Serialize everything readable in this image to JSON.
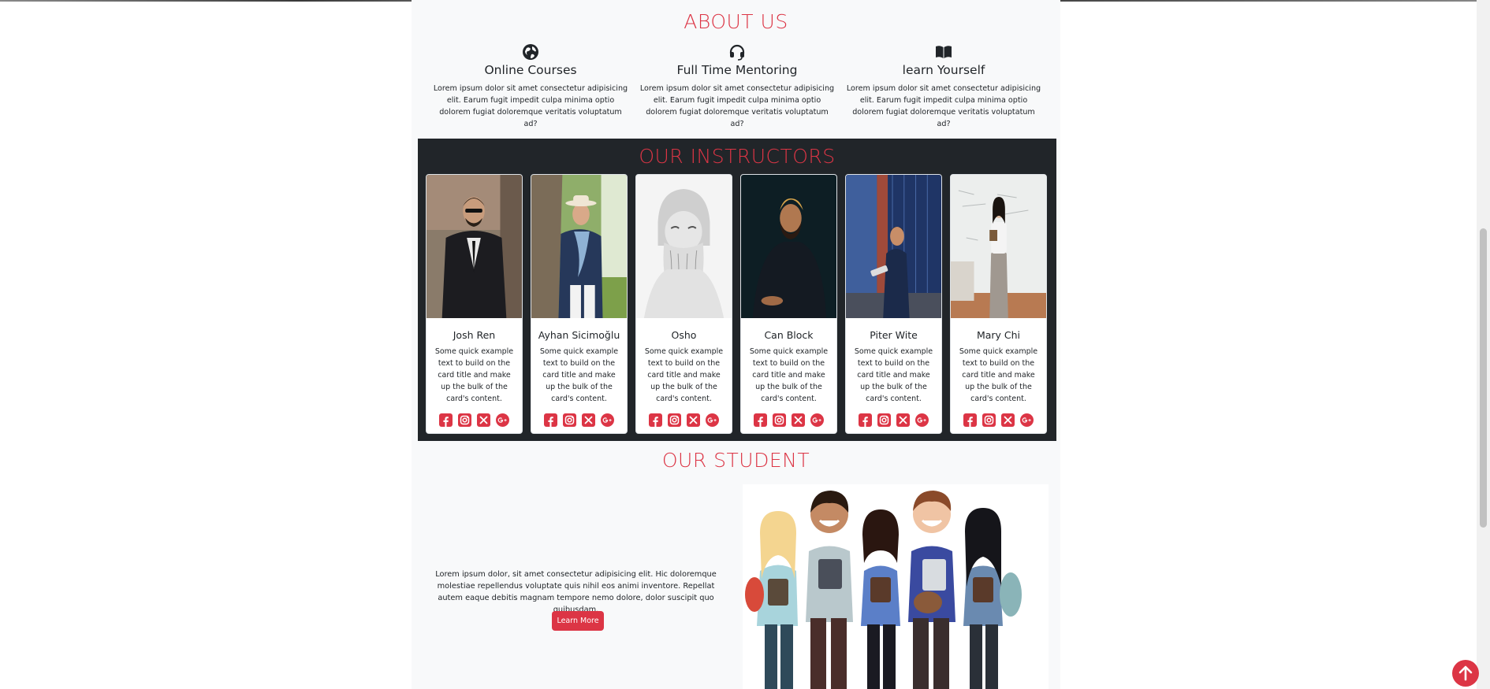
{
  "about": {
    "title": "ABOUT US",
    "features": [
      {
        "icon": "globe-icon",
        "title": "Online Courses",
        "text": "Lorem ipsum dolor sit amet consectetur adipisicing elit. Earum fugit impedit culpa minima optio dolorem fugiat doloremque veritatis voluptatum ad?"
      },
      {
        "icon": "headset-icon",
        "title": "Full Time Mentoring",
        "text": "Lorem ipsum dolor sit amet consectetur adipisicing elit. Earum fugit impedit culpa minima optio dolorem fugiat doloremque veritatis voluptatum ad?"
      },
      {
        "icon": "book-icon",
        "title": "learn Yourself",
        "text": "Lorem ipsum dolor sit amet consectetur adipisicing elit. Earum fugit impedit culpa minima optio dolorem fugiat doloremque veritatis voluptatum ad?"
      }
    ]
  },
  "instructors": {
    "title": "OUR INSTRUCTORS",
    "cards": [
      {
        "name": "Josh Ren",
        "text": "Some quick example text to build on the card title and make up the bulk of the card's content."
      },
      {
        "name": "Ayhan Sicimoğlu",
        "text": "Some quick example text to build on the card title and make up the bulk of the card's content."
      },
      {
        "name": "Osho",
        "text": "Some quick example text to build on the card title and make up the bulk of the card's content."
      },
      {
        "name": "Can Block",
        "text": "Some quick example text to build on the card title and make up the bulk of the card's content."
      },
      {
        "name": "Piter Wite",
        "text": "Some quick example text to build on the card title and make up the bulk of the card's content."
      },
      {
        "name": "Mary Chi",
        "text": "Some quick example text to build on the card title and make up the bulk of the card's content."
      }
    ],
    "social_icons": [
      "facebook-icon",
      "instagram-icon",
      "x-icon",
      "google-plus-icon"
    ]
  },
  "student": {
    "title": "OUR STUDENT",
    "text": "Lorem ipsum dolor, sit amet consectetur adipisicing elit. Hic doloremque molestiae repellendus voluptate quis nihil eos animi inventore. Repellat autem eaque debitis magnam tempore nemo dolore, dolor suscipit quo quibusdam.",
    "button_label": "Learn More"
  },
  "colors": {
    "accent": "#dc3545",
    "dark": "#212529",
    "section_bg": "#f8f9fa"
  }
}
